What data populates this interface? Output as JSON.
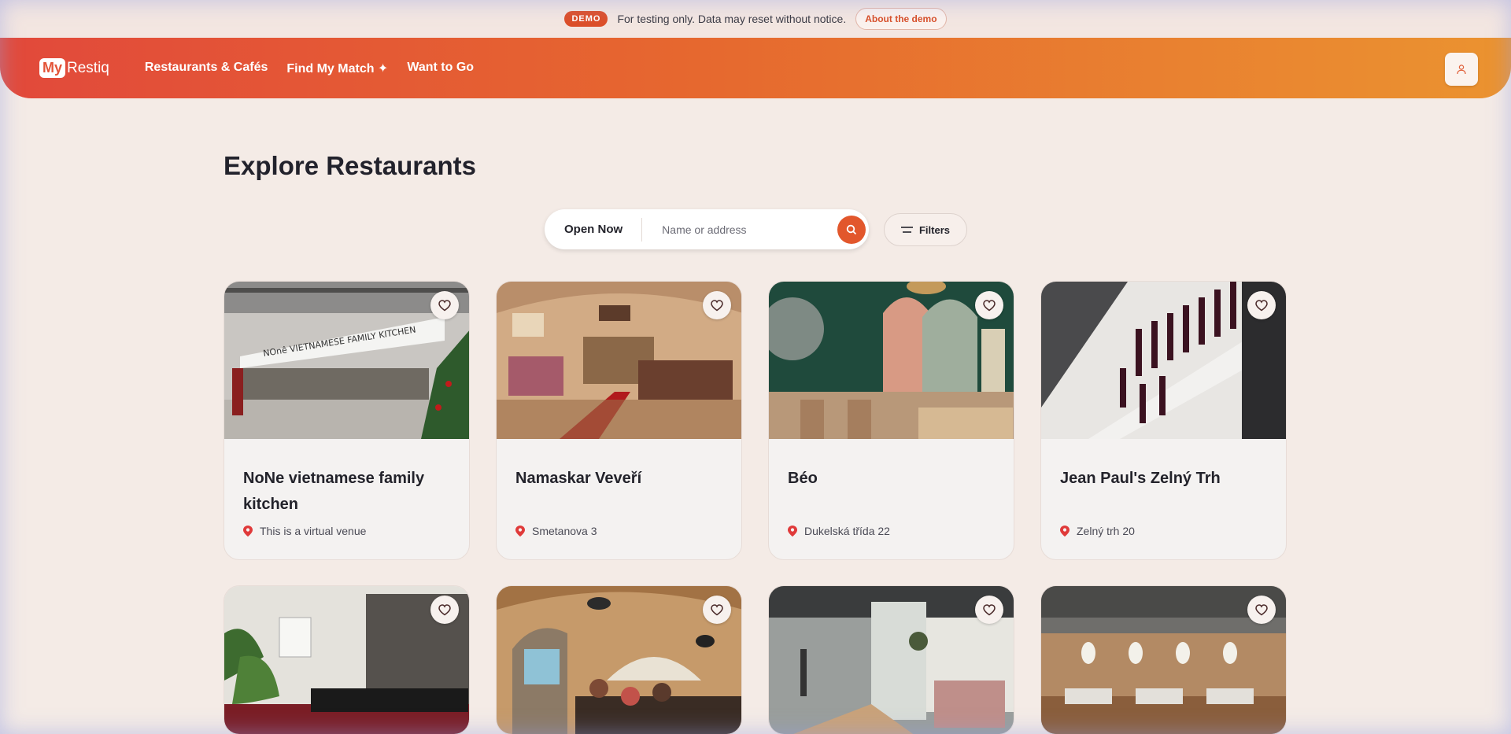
{
  "demo": {
    "badge": "DEMO",
    "notice": "For testing only. Data may reset without notice.",
    "about_link": "About the demo"
  },
  "header": {
    "logo_my": "My",
    "logo_rest": "Restiq",
    "nav": [
      "Restaurants & Cafés",
      "Find My Match ✦",
      "Want to Go"
    ]
  },
  "page": {
    "title": "Explore Restaurants"
  },
  "search": {
    "open_now": "Open Now",
    "placeholder": "Name or address",
    "filters": "Filters"
  },
  "restaurants": [
    {
      "name": "NoNe vietnamese family kitchen",
      "address": "This is a virtual venue"
    },
    {
      "name": "Namaskar Veveří",
      "address": "Smetanova 3"
    },
    {
      "name": "Béo",
      "address": "Dukelská třída 22"
    },
    {
      "name": "Jean Paul's Zelný Trh",
      "address": "Zelný trh 20"
    }
  ],
  "colors": {
    "accent": "#e2572c",
    "header_start": "#e2493b",
    "header_end": "#eb9330",
    "background": "#f4ebe6"
  }
}
